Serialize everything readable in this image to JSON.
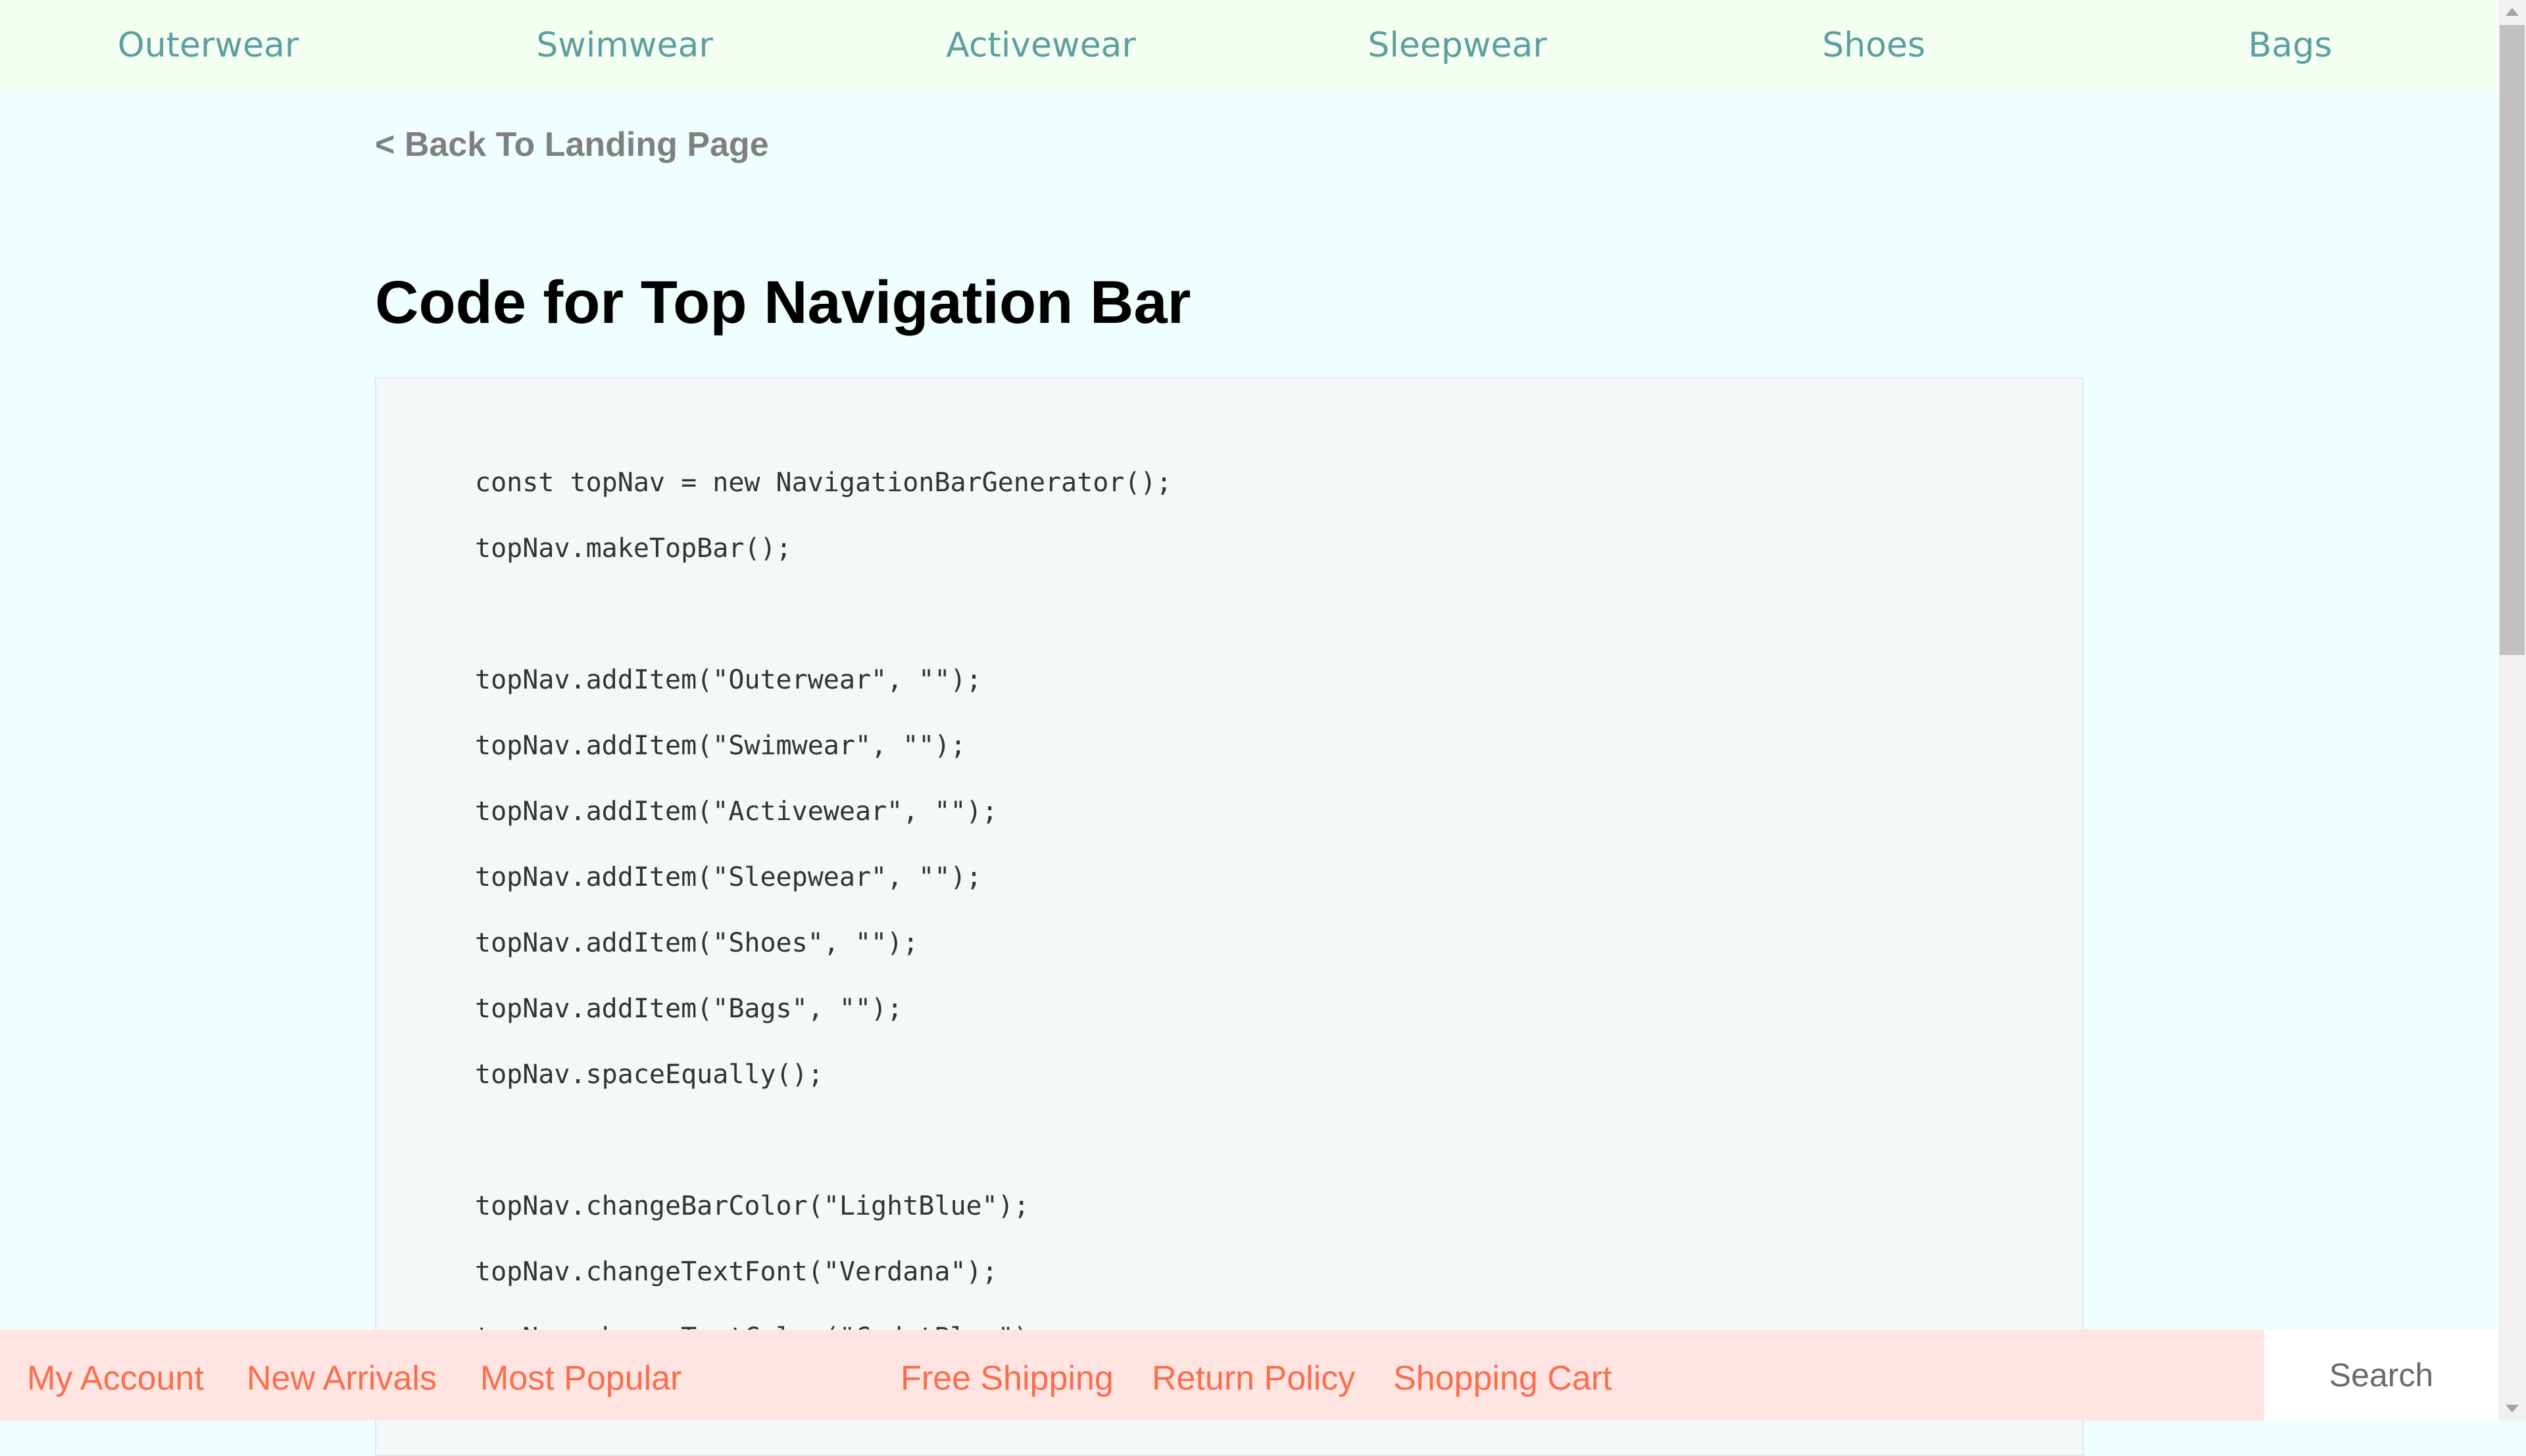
{
  "top_nav": {
    "items": [
      "Outerwear",
      "Swimwear",
      "Activewear",
      "Sleepwear",
      "Shoes",
      "Bags"
    ]
  },
  "main": {
    "back_link": "< Back To Landing Page",
    "title": "Code for Top Navigation Bar",
    "code_lines": [
      "const topNav = new NavigationBarGenerator();",
      "topNav.makeTopBar();",
      "",
      "topNav.addItem(\"Outerwear\", \"\");",
      "topNav.addItem(\"Swimwear\", \"\");",
      "topNav.addItem(\"Activewear\", \"\");",
      "topNav.addItem(\"Sleepwear\", \"\");",
      "topNav.addItem(\"Shoes\", \"\");",
      "topNav.addItem(\"Bags\", \"\");",
      "topNav.spaceEqually();",
      "",
      "topNav.changeBarColor(\"LightBlue\");",
      "topNav.changeTextFont(\"Verdana\");",
      "topNav.changeTextColor(\"CadetBlue\");"
    ]
  },
  "bottom_bar": {
    "items": [
      "My Account",
      "New Arrivals",
      "Most Popular",
      "Free Shipping",
      "Return Policy",
      "Shopping Cart"
    ],
    "search_placeholder": "Search"
  },
  "colors": {
    "page_background": "#effffe",
    "top_nav_background": "#f2fff1",
    "top_nav_text": "#5f9ea0",
    "bottom_bar_background": "#ffe4e1",
    "bottom_bar_text": "#fa6e4c",
    "code_background": "#f4f8f8"
  },
  "icons": {
    "scroll_up": "scroll-up-arrow-icon",
    "scroll_down": "scroll-down-arrow-icon"
  }
}
